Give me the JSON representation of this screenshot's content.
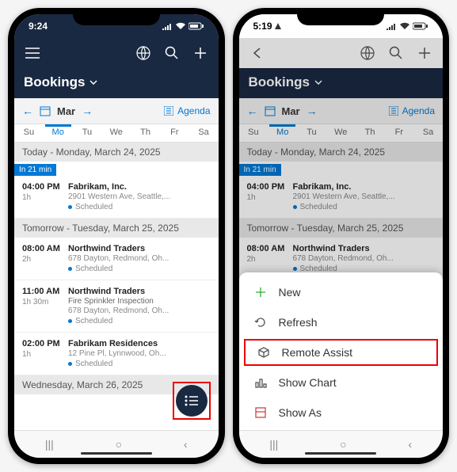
{
  "left": {
    "statusbar": {
      "time": "9:24"
    },
    "title": "Bookings",
    "calendar": {
      "month": "Mar",
      "agenda_label": "Agenda",
      "days": [
        "Su",
        "Mo",
        "Tu",
        "We",
        "Th",
        "Fr",
        "Sa"
      ],
      "selected": "Mo"
    },
    "sections": [
      {
        "header": "Today - Monday, March 24, 2025",
        "badge": "In 21 min",
        "items": [
          {
            "time": "04:00 PM",
            "dur": "1h",
            "title": "Fabrikam, Inc.",
            "addr": "2901 Western Ave, Seattle,...",
            "status": "Scheduled"
          }
        ]
      },
      {
        "header": "Tomorrow - Tuesday, March 25, 2025",
        "items": [
          {
            "time": "08:00 AM",
            "dur": "2h",
            "title": "Northwind Traders",
            "addr": "678 Dayton, Redmond, Oh...",
            "status": "Scheduled"
          },
          {
            "time": "11:00 AM",
            "dur": "1h 30m",
            "title": "Northwind Traders",
            "sub": "Fire Sprinkler Inspection",
            "addr": "678 Dayton, Redmond, Oh...",
            "status": "Scheduled"
          },
          {
            "time": "02:00 PM",
            "dur": "1h",
            "title": "Fabrikam Residences",
            "addr": "12 Pine Pl, Lynnwood, Oh...",
            "status": "Scheduled"
          }
        ]
      },
      {
        "header": "Wednesday, March 26, 2025",
        "items": []
      }
    ]
  },
  "right": {
    "statusbar": {
      "time": "5:19"
    },
    "title": "Bookings",
    "calendar": {
      "month": "Mar",
      "agenda_label": "Agenda",
      "days": [
        "Su",
        "Mo",
        "Tu",
        "We",
        "Th",
        "Fr",
        "Sa"
      ],
      "selected": "Mo"
    },
    "sections": [
      {
        "header": "Today - Monday, March 24, 2025",
        "badge": "In 21 min",
        "items": [
          {
            "time": "04:00 PM",
            "dur": "1h",
            "title": "Fabrikam, Inc.",
            "addr": "2901 Western Ave, Seattle,...",
            "status": "Scheduled"
          }
        ]
      },
      {
        "header": "Tomorrow - Tuesday, March 25, 2025",
        "items": [
          {
            "time": "08:00 AM",
            "dur": "2h",
            "title": "Northwind Traders",
            "addr": "678 Dayton, Redmond, Oh...",
            "status": "Scheduled"
          }
        ]
      }
    ],
    "menu": [
      {
        "icon": "plus",
        "label": "New"
      },
      {
        "icon": "refresh",
        "label": "Refresh"
      },
      {
        "icon": "cube",
        "label": "Remote Assist",
        "highlight": true
      },
      {
        "icon": "chart",
        "label": "Show Chart"
      },
      {
        "icon": "layout",
        "label": "Show As"
      }
    ]
  }
}
